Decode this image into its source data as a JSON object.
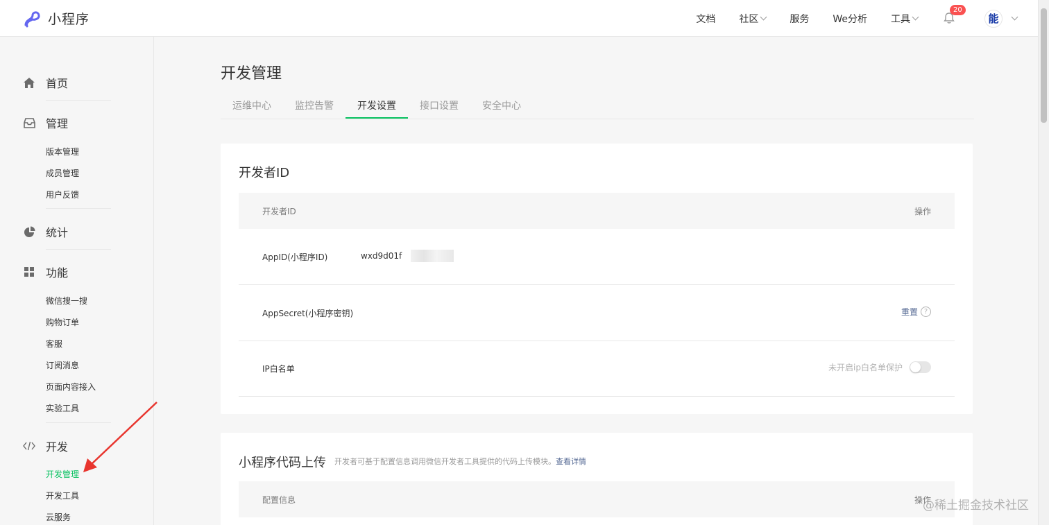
{
  "topbar": {
    "logo_text": "小程序",
    "nav": [
      {
        "label": "文档",
        "has_dropdown": false
      },
      {
        "label": "社区",
        "has_dropdown": true
      },
      {
        "label": "服务",
        "has_dropdown": false
      },
      {
        "label": "We分析",
        "has_dropdown": false
      },
      {
        "label": "工具",
        "has_dropdown": true
      }
    ],
    "notification_count": "20",
    "avatar_char": "能"
  },
  "sidebar": {
    "home": "首页",
    "manage": {
      "label": "管理",
      "items": [
        "版本管理",
        "成员管理",
        "用户反馈"
      ]
    },
    "stats": "统计",
    "features": {
      "label": "功能",
      "items": [
        "微信搜一搜",
        "购物订单",
        "客服",
        "订阅消息",
        "页面内容接入",
        "实验工具"
      ]
    },
    "dev": {
      "label": "开发",
      "items": [
        "开发管理",
        "开发工具",
        "云服务"
      ],
      "active": "开发管理"
    }
  },
  "main": {
    "title": "开发管理",
    "tabs": [
      "运维中心",
      "监控告警",
      "开发设置",
      "接口设置",
      "安全中心"
    ],
    "active_tab": "开发设置",
    "dev_id_card": {
      "title": "开发者ID",
      "col_left": "开发者ID",
      "col_right": "操作",
      "appid_label": "AppID(小程序ID)",
      "appid_value": "wxd9d01f",
      "secret_label": "AppSecret(小程序密钥)",
      "reset_link": "重置",
      "help_glyph": "?",
      "ip_label": "IP白名单",
      "ip_hint": "未开启ip白名单保护"
    },
    "upload_card": {
      "title": "小程序代码上传",
      "desc": "开发者可基于配置信息调用微信开发者工具提供的代码上传模块。",
      "desc_link": "查看详情",
      "col_left": "配置信息",
      "col_right": "操作"
    }
  },
  "watermark": "@稀土掘金技术社区",
  "colors": {
    "accent": "#07c160",
    "link": "#576b95",
    "arrow": "#e8352e"
  }
}
